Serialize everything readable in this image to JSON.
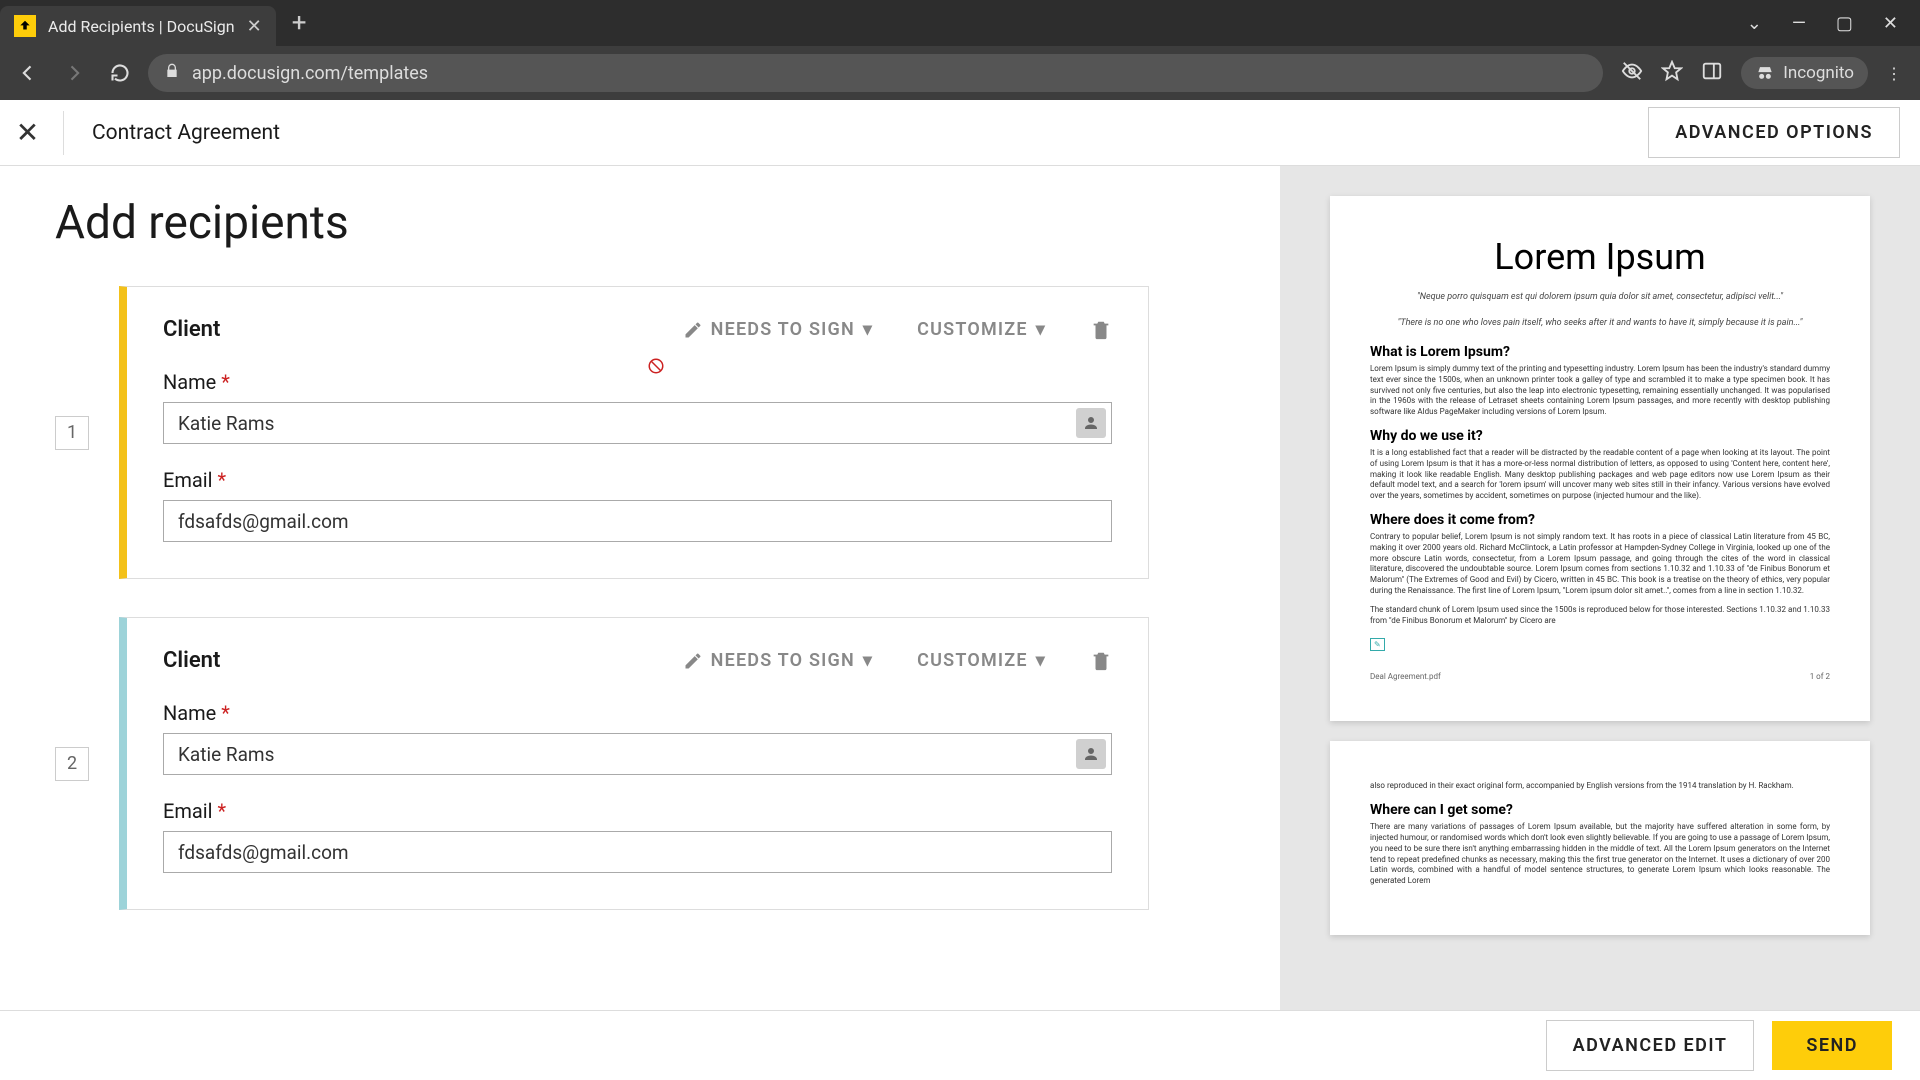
{
  "browser": {
    "tab_title": "Add Recipients | DocuSign",
    "url": "app.docusign.com/templates",
    "incognito_label": "Incognito"
  },
  "header": {
    "doc_name": "Contract Agreement",
    "advanced_options": "ADVANCED OPTIONS"
  },
  "page": {
    "heading": "Add recipients"
  },
  "recipients": [
    {
      "order": "1",
      "color": "yellow",
      "role": "Client",
      "needs_to_sign": "NEEDS TO SIGN",
      "customize": "CUSTOMIZE",
      "name_label": "Name",
      "name_value": "Katie Rams",
      "email_label": "Email",
      "email_value": "fdsafds@gmail.com"
    },
    {
      "order": "2",
      "color": "teal",
      "role": "Client",
      "needs_to_sign": "NEEDS TO SIGN",
      "customize": "CUSTOMIZE",
      "name_label": "Name",
      "name_value": "Katie Rams",
      "email_label": "Email",
      "email_value": "fdsafds@gmail.com"
    }
  ],
  "preview": {
    "title": "Lorem Ipsum",
    "quote1": "\"Neque porro quisquam est qui dolorem ipsum quia dolor sit amet, consectetur, adipisci velit...\"",
    "quote2": "\"There is no one who loves pain itself, who seeks after it and wants to have it, simply because it is pain...\"",
    "h1": "What is Lorem Ipsum?",
    "p1": "Lorem Ipsum is simply dummy text of the printing and typesetting industry. Lorem Ipsum has been the industry's standard dummy text ever since the 1500s, when an unknown printer took a galley of type and scrambled it to make a type specimen book. It has survived not only five centuries, but also the leap into electronic typesetting, remaining essentially unchanged. It was popularised in the 1960s with the release of Letraset sheets containing Lorem Ipsum passages, and more recently with desktop publishing software like Aldus PageMaker including versions of Lorem Ipsum.",
    "h2": "Why do we use it?",
    "p2": "It is a long established fact that a reader will be distracted by the readable content of a page when looking at its layout. The point of using Lorem Ipsum is that it has a more-or-less normal distribution of letters, as opposed to using 'Content here, content here', making it look like readable English. Many desktop publishing packages and web page editors now use Lorem Ipsum as their default model text, and a search for 'lorem ipsum' will uncover many web sites still in their infancy. Various versions have evolved over the years, sometimes by accident, sometimes on purpose (injected humour and the like).",
    "h3": "Where does it come from?",
    "p3": "Contrary to popular belief, Lorem Ipsum is not simply random text. It has roots in a piece of classical Latin literature from 45 BC, making it over 2000 years old. Richard McClintock, a Latin professor at Hampden-Sydney College in Virginia, looked up one of the more obscure Latin words, consectetur, from a Lorem Ipsum passage, and going through the cites of the word in classical literature, discovered the undoubtable source. Lorem Ipsum comes from sections 1.10.32 and 1.10.33 of \"de Finibus Bonorum et Malorum\" (The Extremes of Good and Evil) by Cicero, written in 45 BC. This book is a treatise on the theory of ethics, very popular during the Renaissance. The first line of Lorem Ipsum, \"Lorem ipsum dolor sit amet..\", comes from a line in section 1.10.32.",
    "p3b": "The standard chunk of Lorem Ipsum used since the 1500s is reproduced below for those interested. Sections 1.10.32 and 1.10.33 from \"de Finibus Bonorum et Malorum\" by Cicero are",
    "footer_left": "Deal Agreement.pdf",
    "footer_right": "1 of 2",
    "p4": "also reproduced in their exact original form, accompanied by English versions from the 1914 translation by H. Rackham.",
    "h4": "Where can I get some?",
    "p5": "There are many variations of passages of Lorem Ipsum available, but the majority have suffered alteration in some form, by injected humour, or randomised words which don't look even slightly believable. If you are going to use a passage of Lorem Ipsum, you need to be sure there isn't anything embarrassing hidden in the middle of text. All the Lorem Ipsum generators on the Internet tend to repeat predefined chunks as necessary, making this the first true generator on the Internet. It uses a dictionary of over 200 Latin words, combined with a handful of model sentence structures, to generate Lorem Ipsum which looks reasonable. The generated Lorem"
  },
  "footer": {
    "advanced_edit": "ADVANCED EDIT",
    "send": "SEND"
  }
}
